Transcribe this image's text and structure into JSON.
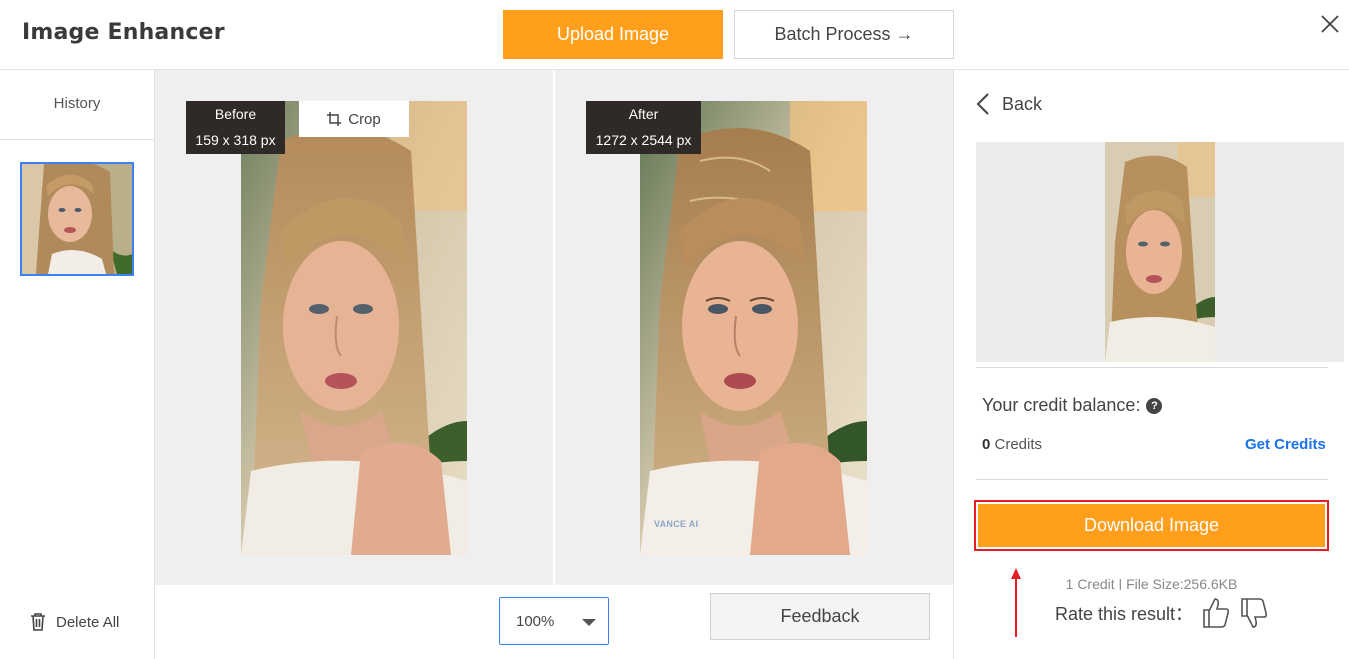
{
  "header": {
    "title": "Image Enhancer",
    "upload_label": "Upload Image",
    "batch_label": "Batch Process →",
    "close_icon": "close-icon"
  },
  "history": {
    "title": "History",
    "delete_all_label": "Delete All",
    "delete_icon": "trash-icon"
  },
  "compare": {
    "before": {
      "label": "Before",
      "size": "159 x 318 px"
    },
    "after": {
      "label": "After",
      "size": "1272 x 2544 px",
      "watermark": "VANCE AI"
    },
    "crop_label": "Crop",
    "crop_icon": "crop-icon"
  },
  "toolbar": {
    "zoom_value": "100%",
    "feedback_label": "Feedback"
  },
  "panel": {
    "back_label": "Back",
    "credit_title": "Your credit balance:",
    "credits_count": "0",
    "credits_unit": "Credits",
    "get_credits_label": "Get Credits",
    "download_label": "Download Image",
    "file_info": "1 Credit | File Size:256.6KB",
    "rate_label": "Rate this result："
  },
  "colors": {
    "accent": "#ff9f1c",
    "link": "#1a73e8",
    "highlight": "#e31e24",
    "selection": "#3b82f6"
  }
}
